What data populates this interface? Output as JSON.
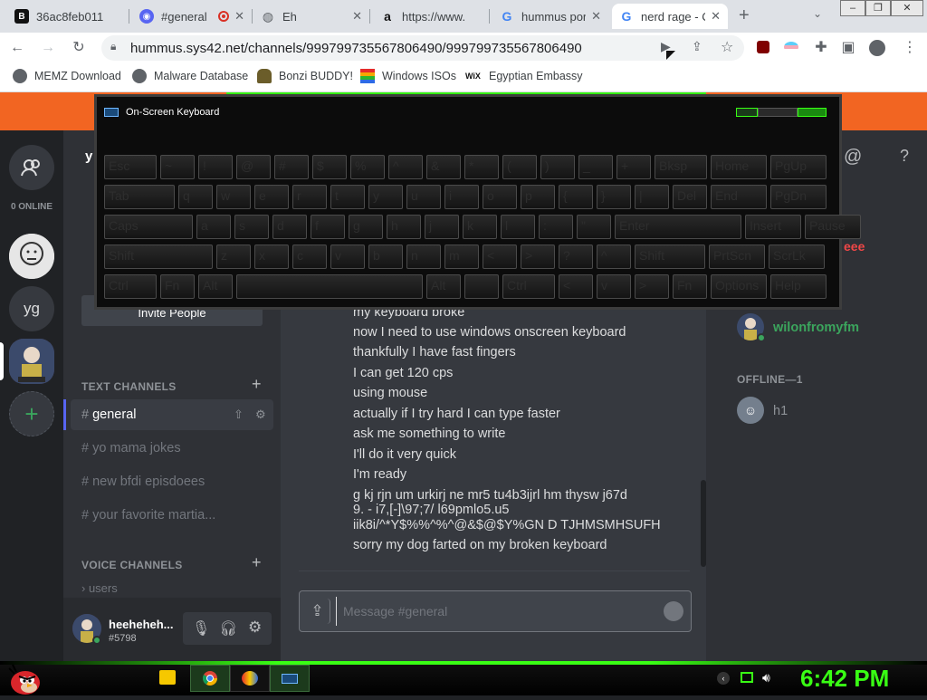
{
  "browser": {
    "tabs": [
      {
        "title": "36ac8feb011",
        "icon": "b-icon",
        "active": false
      },
      {
        "title": "#general",
        "icon": "discord-icon",
        "active": false,
        "recording": true
      },
      {
        "title": "Eh",
        "icon": "globe-icon",
        "active": false
      },
      {
        "title": "https://www.",
        "icon": "amazon-icon",
        "active": false
      },
      {
        "title": "hummus por",
        "icon": "google-icon",
        "active": false
      },
      {
        "title": "nerd rage - C",
        "icon": "google-icon",
        "active": true
      }
    ],
    "url": "hummus.sys42.net/channels/999799735567806490/999799735567806490",
    "bookmarks": [
      {
        "label": "MEMZ Download",
        "icon": "globe-icon"
      },
      {
        "label": "Malware Database",
        "icon": "globe-icon"
      },
      {
        "label": "Bonzi BUDDY!",
        "icon": "bonzi-icon"
      },
      {
        "label": "Windows ISOs",
        "icon": "windows-flag-icon"
      },
      {
        "label": "Egyptian Embassy",
        "icon": "wix-icon"
      }
    ],
    "wix_text": "WiX"
  },
  "discord": {
    "online_count": "0 ONLINE",
    "server_yg": "yg",
    "server_header_partial": "y",
    "invite_label": "Invite People",
    "text_channels_label": "TEXT CHANNELS",
    "voice_channels_label": "VOICE CHANNELS",
    "channels": [
      {
        "name": "general",
        "selected": true
      },
      {
        "name": "yo mama jokes",
        "selected": false
      },
      {
        "name": "new bfdi episdoees",
        "selected": false
      },
      {
        "name": "your favorite martia...",
        "selected": false
      }
    ],
    "voice_channels": [
      {
        "name": "users"
      }
    ],
    "user": {
      "name": "heeheheh...",
      "tag": "#5798"
    },
    "messages": [
      "my keyboard broke",
      "now I need to use windows onscreen keyboard",
      "thankfully I have fast fingers",
      "I can get 120 cps",
      "using mouse",
      "actually if I try hard I can type faster",
      "ask me something to write",
      "I'll do it very quick",
      "I'm ready",
      "g kj rjn um urkirj ne  mr5 tu4b3ijrl hm thysw j67d",
      "9. - i7,[-]\\97;7/ l69pmlo5.u5",
      "iik8i/^*Y$%%^%^@&$@$Y%GN D TJHMSMHSUFH",
      "sorry my dog farted on my broken keyboard"
    ],
    "composer_placeholder": "Message #general",
    "members": {
      "partial_name": "eee",
      "online_member": "wilonfromyfm",
      "offline_label": "OFFLINE—1",
      "offline_member": "h1"
    },
    "header_icons": [
      "at-icon",
      "help-icon"
    ]
  },
  "osk": {
    "title": "On-Screen Keyboard",
    "rows": [
      [
        "Esc",
        "~",
        "!",
        "@",
        "#",
        "$",
        "%",
        "^",
        "&",
        "*",
        "(",
        ")",
        "_",
        "+",
        "Bksp",
        "Home",
        "PgUp"
      ],
      [
        "Tab",
        "q",
        "w",
        "e",
        "r",
        "t",
        "y",
        "u",
        "i",
        "o",
        "p",
        "{",
        "}",
        "|",
        "Del",
        "End",
        "PgDn"
      ],
      [
        "Caps",
        "a",
        "s",
        "d",
        "f",
        "g",
        "h",
        "j",
        "k",
        "l",
        ":",
        "\"",
        "Enter",
        "Insert",
        "Pause"
      ],
      [
        "Shift",
        "z",
        "x",
        "c",
        "v",
        "b",
        "n",
        "m",
        "<",
        ">",
        "?",
        "^",
        "Shift",
        "PrtScn",
        "ScrLk"
      ],
      [
        "Ctrl",
        "Fn",
        "Alt",
        "",
        "Alt",
        "",
        "Ctrl",
        "<",
        "v",
        ">",
        "Fn",
        "Options",
        "Help"
      ]
    ]
  },
  "taskbar": {
    "clock": "6:42 PM",
    "apps": [
      "folder-icon",
      "chrome-icon",
      "paint-icon",
      "keyboard-icon"
    ]
  },
  "colors": {
    "accent_green": "#39ff14",
    "discord_orange": "#f26522",
    "online": "#3ba55d"
  }
}
